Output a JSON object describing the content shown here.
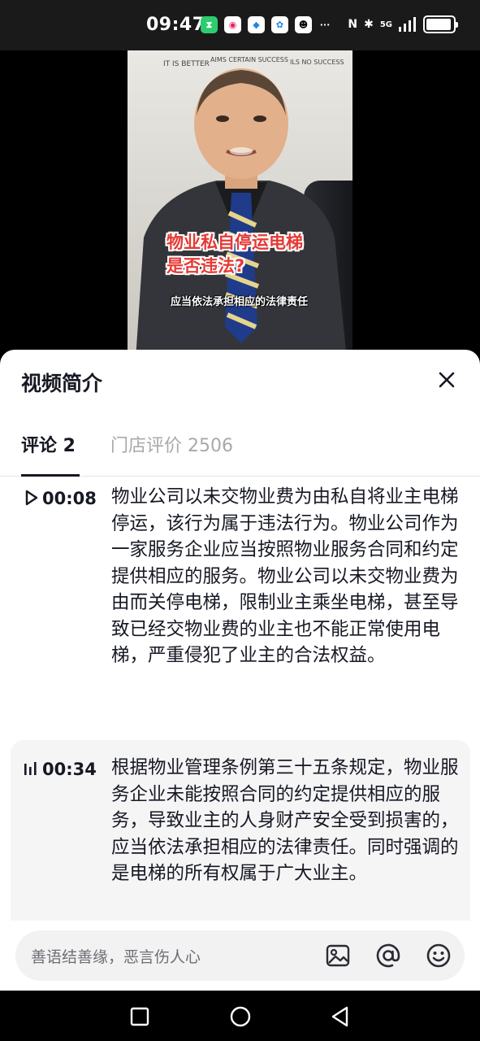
{
  "status_bar": {
    "time": "09:47",
    "network": "5G"
  },
  "video": {
    "caption_title": "物业私自停运电梯\n是否违法?",
    "caption_sub": "应当依法承担相应的法律责任",
    "wall_text": [
      "IT IS BETTER",
      "AIMS CERTAIN SUCCESS",
      "ILS NO SUCCESS"
    ]
  },
  "sheet": {
    "title": "视频简介",
    "tabs": [
      {
        "label": "评论 2",
        "active": true
      },
      {
        "label": "门店评价 2506",
        "active": false
      }
    ],
    "chapters": [
      {
        "time": "00:08",
        "icon": "play-icon",
        "text": "物业公司以未交物业费为由私自将业主电梯停运，该行为属于违法行为。物业公司作为一家服务企业应当按照物业服务合同和约定提供相应的服务。物业公司以未交物业费为由而关停电梯，限制业主乘坐电梯，甚至导致已经交物业费的业主也不能正常使用电梯，严重侵犯了业主的合法权益。"
      },
      {
        "time": "00:34",
        "icon": "playing-bars-icon",
        "text": "根据物业管理条例第三十五条规定，物业服务企业未能按照合同的约定提供相应的服务，导致业主的人身财产安全受到损害的，应当依法承担相应的法律责任。同时强调的是电梯的所有权属于广大业主。"
      }
    ],
    "input": {
      "placeholder": "善语结善缘，恶言伤人心"
    }
  },
  "colors": {
    "accent_text": "#161823",
    "muted_text": "#a8a9ad",
    "caption_red": "#e53935"
  }
}
